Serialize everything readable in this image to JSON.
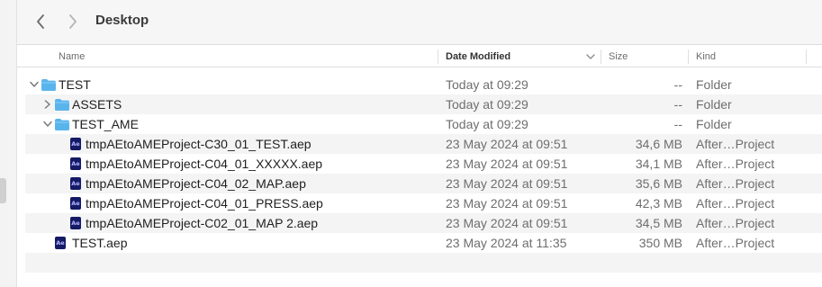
{
  "window": {
    "title": "Desktop"
  },
  "columns": {
    "name": "Name",
    "date_modified": "Date Modified",
    "size": "Size",
    "kind": "Kind"
  },
  "file_icon_label": "Ae",
  "rows": [
    {
      "name": "TEST",
      "date": "Today at 09:29",
      "size": "--",
      "kind": "Folder",
      "type": "folder",
      "indent": 0,
      "expanded": true
    },
    {
      "name": "ASSETS",
      "date": "Today at 09:29",
      "size": "--",
      "kind": "Folder",
      "type": "folder",
      "indent": 1,
      "expanded": false
    },
    {
      "name": "TEST_AME",
      "date": "Today at 09:29",
      "size": "--",
      "kind": "Folder",
      "type": "folder",
      "indent": 1,
      "expanded": true
    },
    {
      "name": "tmpAEtoAMEProject-C30_01_TEST.aep",
      "date": "23 May 2024 at 09:51",
      "size": "34,6 MB",
      "kind": "After…Project",
      "type": "aep",
      "indent": 2
    },
    {
      "name": "tmpAEtoAMEProject-C04_01_XXXXX.aep",
      "date": "23 May 2024 at 09:51",
      "size": "34,1 MB",
      "kind": "After…Project",
      "type": "aep",
      "indent": 2
    },
    {
      "name": "tmpAEtoAMEProject-C04_02_MAP.aep",
      "date": "23 May 2024 at 09:51",
      "size": "35,6 MB",
      "kind": "After…Project",
      "type": "aep",
      "indent": 2
    },
    {
      "name": "tmpAEtoAMEProject-C04_01_PRESS.aep",
      "date": "23 May 2024 at 09:51",
      "size": "42,3 MB",
      "kind": "After…Project",
      "type": "aep",
      "indent": 2
    },
    {
      "name": "tmpAEtoAMEProject-C02_01_MAP 2.aep",
      "date": "23 May 2024 at 09:51",
      "size": "34,5 MB",
      "kind": "After…Project",
      "type": "aep",
      "indent": 2
    },
    {
      "name": "TEST.aep",
      "date": "23 May 2024 at 11:35",
      "size": "350 MB",
      "kind": "After…Project",
      "type": "aep",
      "indent": 1
    }
  ],
  "colors": {
    "folder": "#5ab4ec",
    "aep_bg": "#141a66",
    "aep_text": "#b6b6ff",
    "zebra": "#f4f4f5"
  },
  "icons": {
    "back": "chevron-left-icon",
    "forward": "chevron-right-icon",
    "sort": "chevron-down-icon",
    "folder": "folder-icon",
    "aep": "after-effects-file-icon"
  }
}
